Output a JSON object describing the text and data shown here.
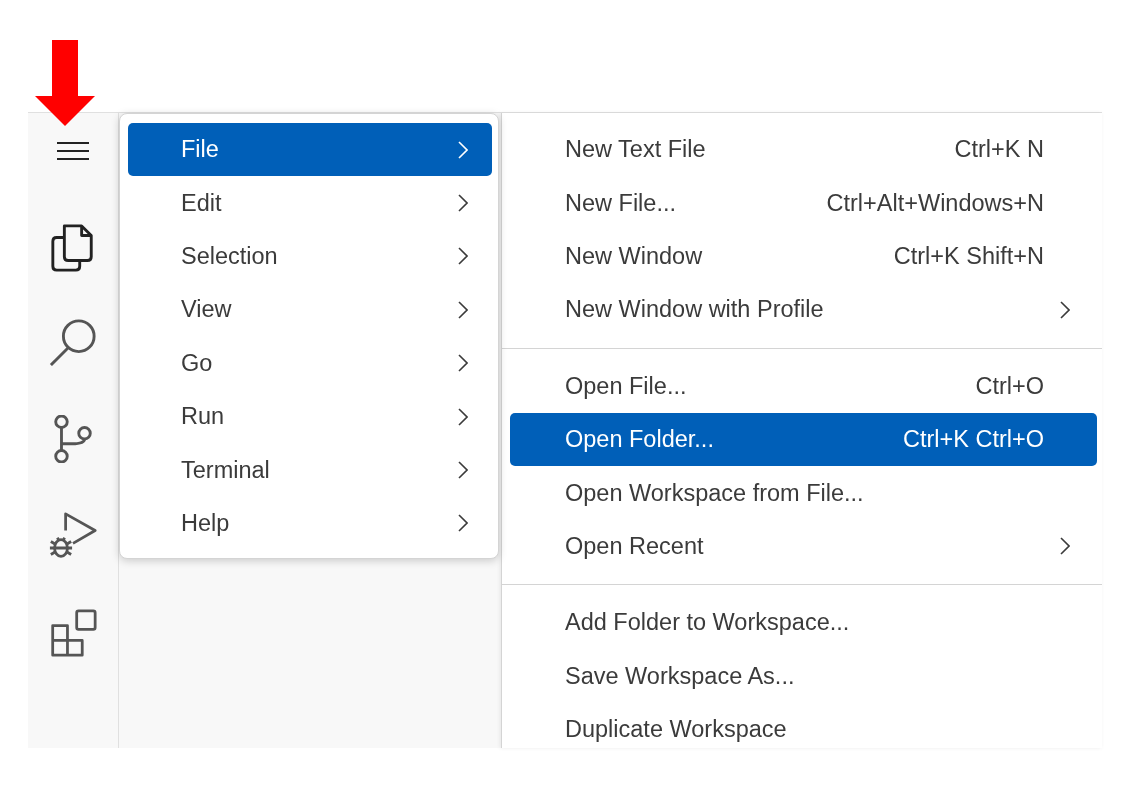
{
  "menu": {
    "items": [
      {
        "label": "File",
        "selected": true,
        "has_submenu": true
      },
      {
        "label": "Edit",
        "selected": false,
        "has_submenu": true
      },
      {
        "label": "Selection",
        "selected": false,
        "has_submenu": true
      },
      {
        "label": "View",
        "selected": false,
        "has_submenu": true
      },
      {
        "label": "Go",
        "selected": false,
        "has_submenu": true
      },
      {
        "label": "Run",
        "selected": false,
        "has_submenu": true
      },
      {
        "label": "Terminal",
        "selected": false,
        "has_submenu": true
      },
      {
        "label": "Help",
        "selected": false,
        "has_submenu": true
      }
    ]
  },
  "submenu": {
    "groups": [
      {
        "items": [
          {
            "label": "New Text File",
            "shortcut": "Ctrl+K N",
            "selected": false,
            "has_submenu": false
          },
          {
            "label": "New File...",
            "shortcut": "Ctrl+Alt+Windows+N",
            "selected": false,
            "has_submenu": false
          },
          {
            "label": "New Window",
            "shortcut": "Ctrl+K Shift+N",
            "selected": false,
            "has_submenu": false
          },
          {
            "label": "New Window with Profile",
            "selected": false,
            "has_submenu": true
          }
        ]
      },
      {
        "items": [
          {
            "label": "Open File...",
            "shortcut": "Ctrl+O",
            "selected": false,
            "has_submenu": false
          },
          {
            "label": "Open Folder...",
            "shortcut": "Ctrl+K Ctrl+O",
            "selected": true,
            "has_submenu": false
          },
          {
            "label": "Open Workspace from File...",
            "selected": false,
            "has_submenu": false
          },
          {
            "label": "Open Recent",
            "selected": false,
            "has_submenu": true
          }
        ]
      },
      {
        "items": [
          {
            "label": "Add Folder to Workspace...",
            "selected": false,
            "has_submenu": false
          },
          {
            "label": "Save Workspace As...",
            "selected": false,
            "has_submenu": false
          },
          {
            "label": "Duplicate Workspace",
            "selected": false,
            "has_submenu": false
          }
        ]
      }
    ]
  }
}
